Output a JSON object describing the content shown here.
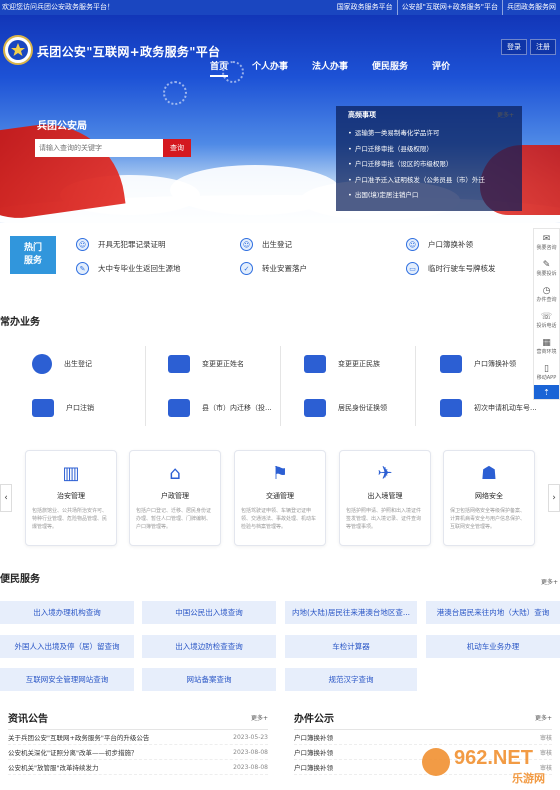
{
  "topbar": {
    "welcome": "欢迎您访问兵团公安政务服务平台！",
    "links": [
      "国家政务服务平台",
      "公安部\"互联网+政务服务\"平台",
      "兵团政务服务网"
    ]
  },
  "header": {
    "title": "兵团公安\"互联网+政务服务\"平台",
    "login": "登录",
    "register": "注册",
    "nav": [
      "首页",
      "个人办事",
      "法人办事",
      "便民服务",
      "评价"
    ]
  },
  "hero": {
    "bureau": "兵团公安局",
    "search_placeholder": "请输入查询的关键字",
    "search_button": "查询",
    "hot": {
      "title": "高频事项",
      "more": "更多+",
      "items": [
        "运输第一类易制毒化学品许可",
        "户口迁移审批（县级权限）",
        "户口迁移审批（设区的市级权限）",
        "户口准予迁入证明核发（公务员县（市）外迁",
        "出国(境)定居注销户口"
      ]
    }
  },
  "quick": {
    "badge_line1": "热门",
    "badge_line2": "服务",
    "items": [
      "开具无犯罪记录证明",
      "出生登记",
      "户口簿换补领",
      "大中专毕业生返回生源地",
      "转业安置落户",
      "临时行驶车号牌核发"
    ]
  },
  "side": [
    "我要咨询",
    "我要投诉",
    "办件查询",
    "投诉电话",
    "营商环境",
    "移动APP"
  ],
  "common": {
    "title": "常办业务",
    "items": [
      "出生登记",
      "变更更正姓名",
      "变更更正民族",
      "户口簿换补领",
      "户口注销",
      "县（市）内迁移（投...",
      "居民身份证换领",
      "初次申请机动车号..."
    ]
  },
  "cards": [
    {
      "title": "治安管理",
      "desc": "包括旅馆业、公共场所治安许可、特种行业管理、危险物品管理、民爆管理等。"
    },
    {
      "title": "户政管理",
      "desc": "包括户口登记、迁移、居民身份证办理、暂住人口管理、门牌编制、户口簿管理等。"
    },
    {
      "title": "交通管理",
      "desc": "包括驾驶证申领、车辆登记证申领、交通违法、事故处理、机动车检验与档案管理等。"
    },
    {
      "title": "出入境管理",
      "desc": "包括护照申请、护照和出入境证件签发管理、出入境记录、证件查询等管理事项。"
    },
    {
      "title": "网络安全",
      "desc": "保卫包括网络安全等级保护备案、计算机病毒安全与用户信息保护、互联网安全管理等。"
    }
  ],
  "convenience": {
    "title": "便民服务",
    "more": "更多+",
    "items": [
      "出入境办理机构查询",
      "中国公民出入境查询",
      "内地(大陆)居民往来港澳台地区查...",
      "港澳台居民来往内地（大陆）查询",
      "外国人入出境及停（居）留查询",
      "出入境边防检查查询",
      "车检计算器",
      "机动车业务办理",
      "互联网安全管理网站查询",
      "网站备案查询",
      "规范汉字查询"
    ]
  },
  "news": {
    "title": "资讯公告",
    "more": "更多+",
    "rows": [
      {
        "text": "关于兵团公安\"互联网+政务服务\"平台的升级公告",
        "date": "2023-05-23"
      },
      {
        "text": "公安机关深化\"证照分离\"改革——初步措施？",
        "date": "2023-08-08"
      },
      {
        "text": "公安机关\"放管服\"改革持续发力",
        "date": "2023-08-08"
      }
    ]
  },
  "affairs": {
    "title": "办件公示",
    "more": "更多+",
    "rows": [
      {
        "text": "户口簿换补领",
        "status": "审核"
      },
      {
        "text": "户口簿换补领",
        "status": "审核"
      },
      {
        "text": "户口簿换补领",
        "status": "审核"
      }
    ]
  },
  "watermark": {
    "brand": "962.NET",
    "sub": "乐游网"
  }
}
